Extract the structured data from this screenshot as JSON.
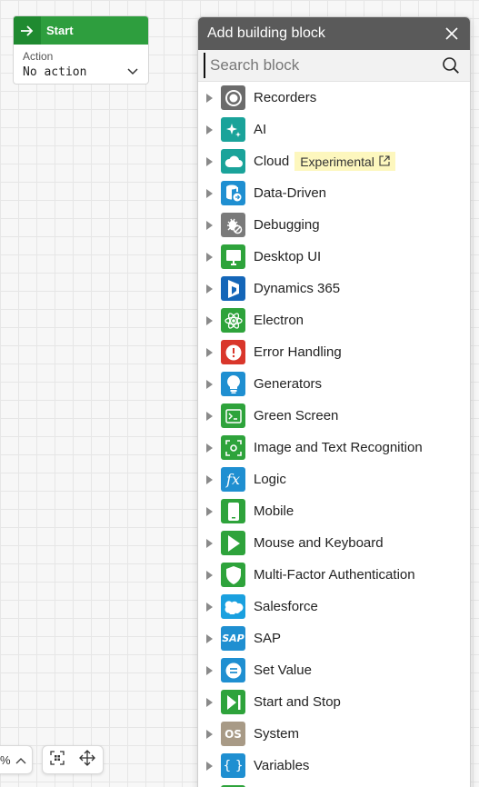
{
  "start_node": {
    "title": "Start",
    "action_label": "Action",
    "action_value": "No action"
  },
  "zoom": {
    "suffix": "%"
  },
  "panel": {
    "title": "Add building block",
    "search_placeholder": "Search block",
    "items": [
      {
        "label": "Recorders",
        "icon": "record-icon",
        "color": "#6b6b6b"
      },
      {
        "label": "AI",
        "icon": "sparkle-icon",
        "color": "#1aa39a"
      },
      {
        "label": "Cloud",
        "icon": "cloud-icon",
        "color": "#1aa39a",
        "badge": "Experimental"
      },
      {
        "label": "Data-Driven",
        "icon": "database-icon",
        "color": "#1f8fd1"
      },
      {
        "label": "Debugging",
        "icon": "bug-icon",
        "color": "#7a7a7a"
      },
      {
        "label": "Desktop UI",
        "icon": "monitor-icon",
        "color": "#2ea33b"
      },
      {
        "label": "Dynamics 365",
        "icon": "dynamics-icon",
        "color": "#1466b8"
      },
      {
        "label": "Electron",
        "icon": "atom-icon",
        "color": "#2ea33b"
      },
      {
        "label": "Error Handling",
        "icon": "error-icon",
        "color": "#d9362b"
      },
      {
        "label": "Generators",
        "icon": "bulb-icon",
        "color": "#1f8fd1"
      },
      {
        "label": "Green Screen",
        "icon": "terminal-icon",
        "color": "#2ea33b"
      },
      {
        "label": "Image and Text Recognition",
        "icon": "focus-icon",
        "color": "#2ea33b"
      },
      {
        "label": "Logic",
        "icon": "function-icon",
        "color": "#1f8fd1",
        "tile_text": "fx"
      },
      {
        "label": "Mobile",
        "icon": "phone-icon",
        "color": "#2ea33b"
      },
      {
        "label": "Mouse and Keyboard",
        "icon": "cursor-icon",
        "color": "#2ea33b"
      },
      {
        "label": "Multi-Factor Authentication",
        "icon": "shield-icon",
        "color": "#2ea33b"
      },
      {
        "label": "Salesforce",
        "icon": "salesforce-icon",
        "color": "#1aa0df"
      },
      {
        "label": "SAP",
        "icon": "sap-icon",
        "color": "#1f8fd1",
        "tile_text": "SAP"
      },
      {
        "label": "Set Value",
        "icon": "equals-icon",
        "color": "#1f8fd1"
      },
      {
        "label": "Start and Stop",
        "icon": "play-stop-icon",
        "color": "#2ea33b"
      },
      {
        "label": "System",
        "icon": "os-icon",
        "color": "#a89a86",
        "tile_text": "OS"
      },
      {
        "label": "Variables",
        "icon": "braces-icon",
        "color": "#1f8fd1",
        "tile_text": "{ }"
      }
    ]
  }
}
